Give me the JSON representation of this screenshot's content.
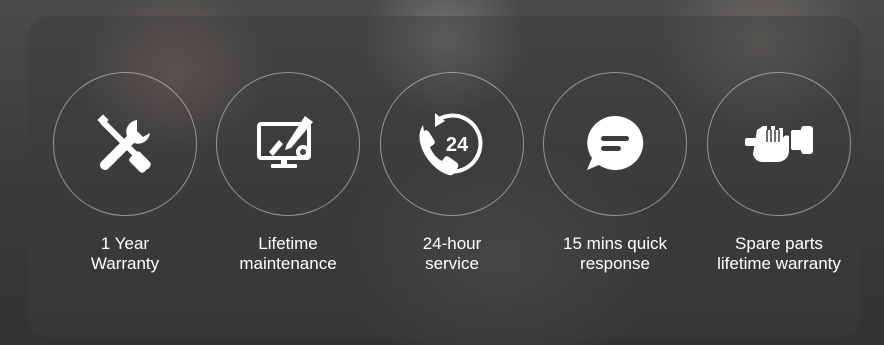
{
  "features": [
    {
      "icon": "wrench-screwdriver-icon",
      "line1": "1 Year",
      "line2": "Warranty"
    },
    {
      "icon": "monitor-maintenance-icon",
      "line1": "Lifetime",
      "line2": "maintenance"
    },
    {
      "icon": "phone-24-hour-icon",
      "line1": "24-hour",
      "line2": "service"
    },
    {
      "icon": "chat-bubble-icon",
      "line1": "15 mins quick",
      "line2": "response"
    },
    {
      "icon": "hand-wrench-icon",
      "line1": "Spare parts",
      "line2": "lifetime warranty"
    }
  ],
  "icon_text": {
    "hours": "24"
  },
  "colors": {
    "icon": "#ffffff",
    "ring": "rgba(255,255,255,0.45)"
  }
}
